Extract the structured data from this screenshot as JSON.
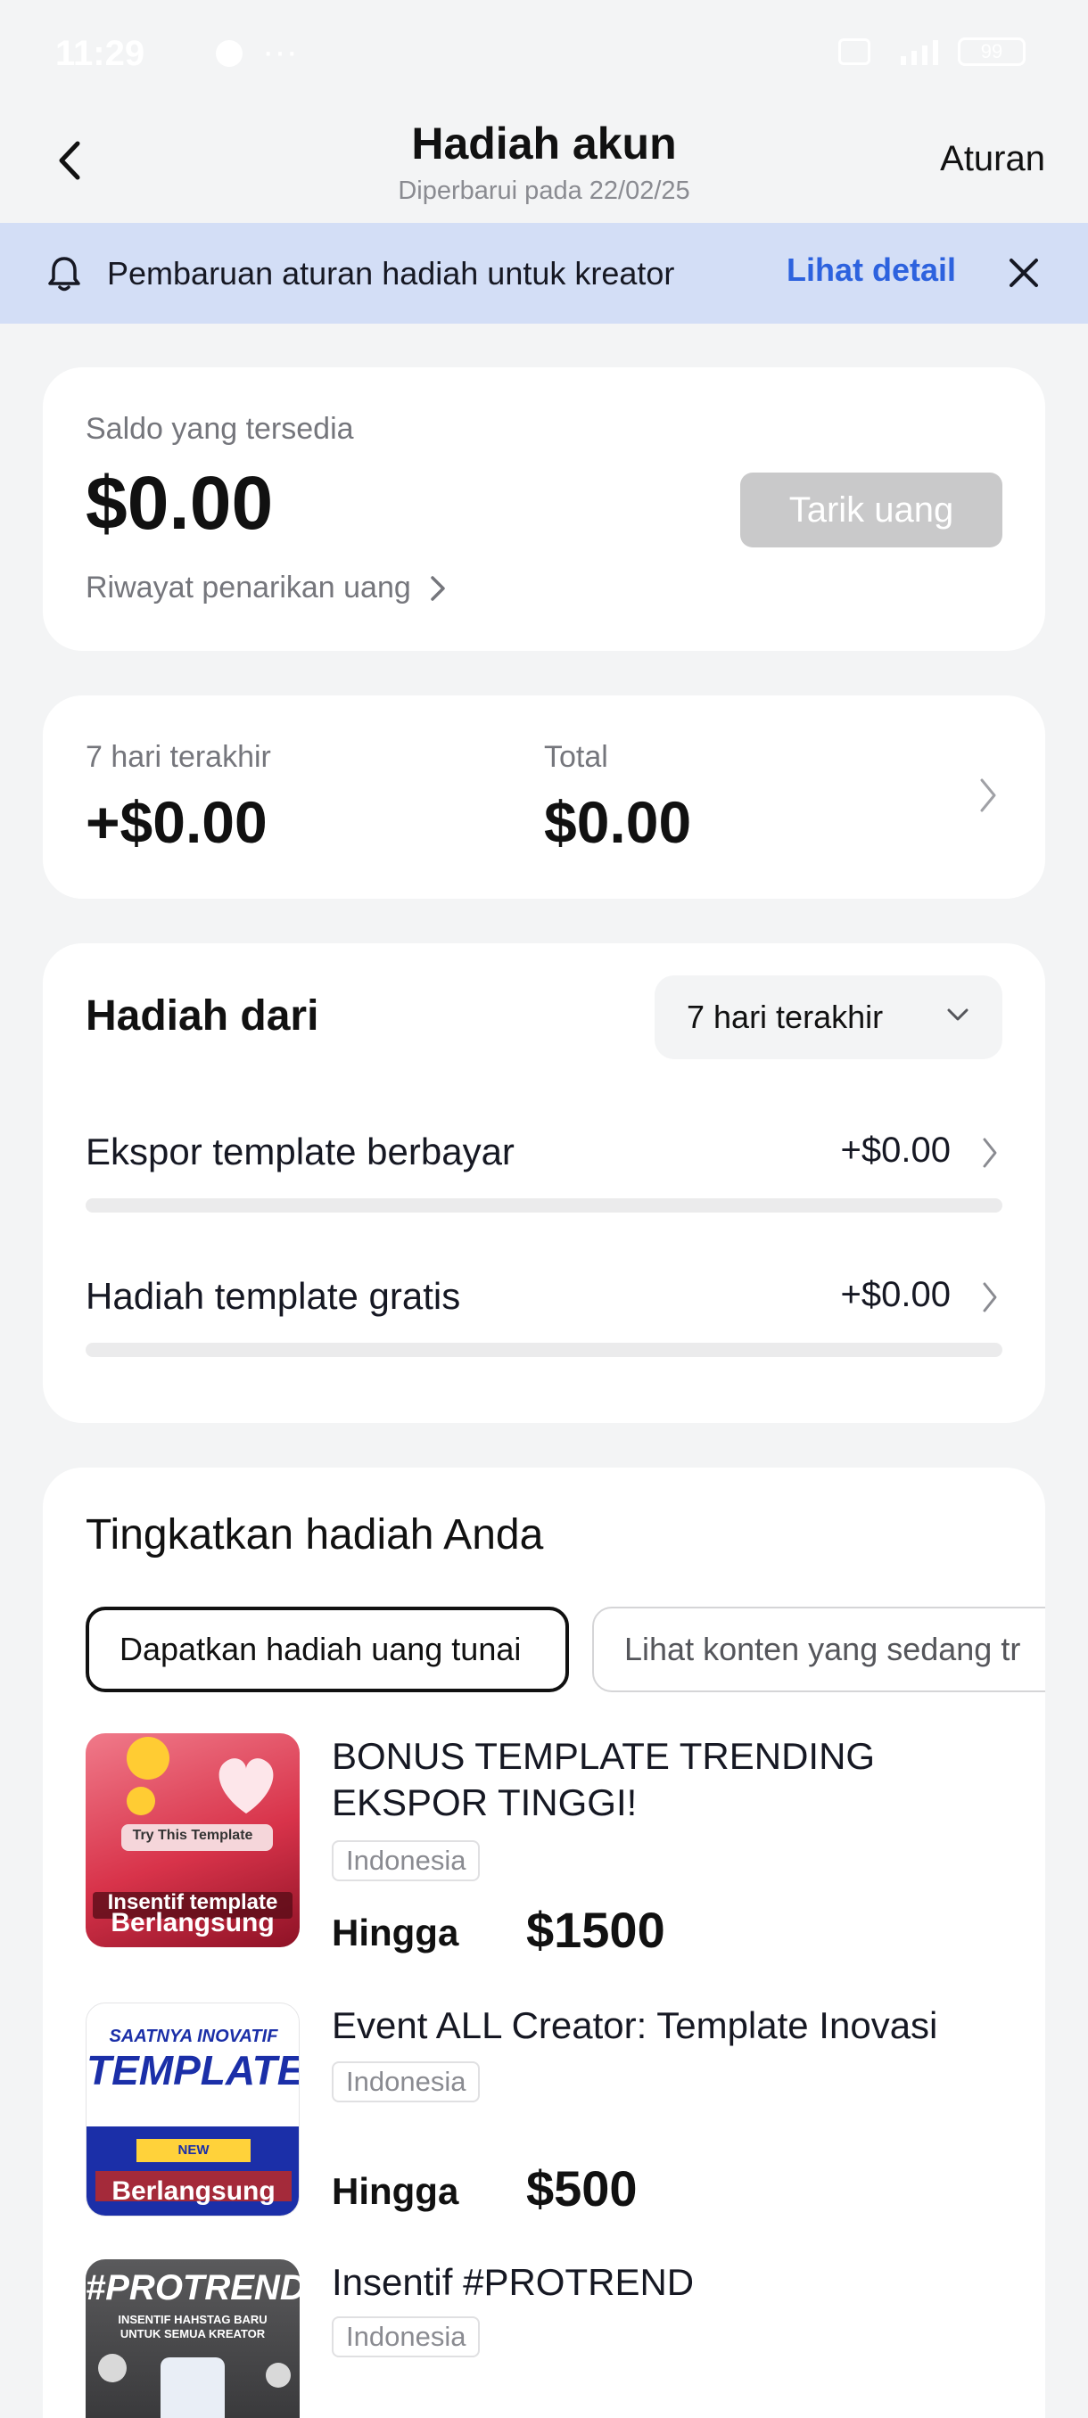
{
  "status_bar": {
    "time": "11:29",
    "extra": "···",
    "battery": "99"
  },
  "header": {
    "title": "Hadiah akun",
    "subtitle": "Diperbarui pada 22/02/25",
    "rules_label": "Aturan"
  },
  "banner": {
    "text": "Pembaruan aturan hadiah untuk kreator",
    "link_label": "Lihat detail"
  },
  "balance": {
    "label": "Saldo yang tersedia",
    "amount": "$0.00",
    "withdraw_label": "Tarik uang",
    "history_label": "Riwayat penarikan uang"
  },
  "stats": {
    "last7_label": "7 hari terakhir",
    "last7_value": "+$0.00",
    "total_label": "Total",
    "total_value": "$0.00"
  },
  "rewards": {
    "title": "Hadiah dari",
    "period": "7 hari terakhir",
    "sources": [
      {
        "label": "Ekspor template berbayar",
        "value": "+$0.00",
        "fraction": 0
      },
      {
        "label": "Hadiah template gratis",
        "value": "+$0.00",
        "fraction": 0
      }
    ]
  },
  "upgrade": {
    "title": "Tingkatkan hadiah Anda",
    "tabs": [
      {
        "label": "Dapatkan hadiah uang tunai",
        "active": true
      },
      {
        "label": "Lihat konten yang sedang tr",
        "active": false
      }
    ],
    "promos": [
      {
        "title": "BONUS TEMPLATE TRENDING EKSPOR TINGGI!",
        "region": "Indonesia",
        "upto_label": "Hingga",
        "amount": "$1500",
        "thumb_caption": "Insentif template",
        "thumb_badge": "Try This Template",
        "status": "Berlangsung"
      },
      {
        "title": "Event ALL Creator: Template Inovasi",
        "region": "Indonesia",
        "upto_label": "Hingga",
        "amount": "$500",
        "thumb_caption": "SAATNYA INOVATIF",
        "thumb_heading": "TEMPLATE",
        "thumb_badge": "NEW TEMPLATE...",
        "status": "Berlangsung"
      },
      {
        "title": "Insentif #PROTREND",
        "region": "Indonesia",
        "thumb_heading": "#PROTREND",
        "thumb_caption": "INSENTIF HAHSTAG BARU UNTUK SEMUA KREATOR"
      }
    ]
  },
  "colors": {
    "accent": "#2d62de",
    "banner_bg": "#d3def6",
    "disabled_button": "#c9c9ca",
    "page_bg": "#f3f4f5"
  }
}
